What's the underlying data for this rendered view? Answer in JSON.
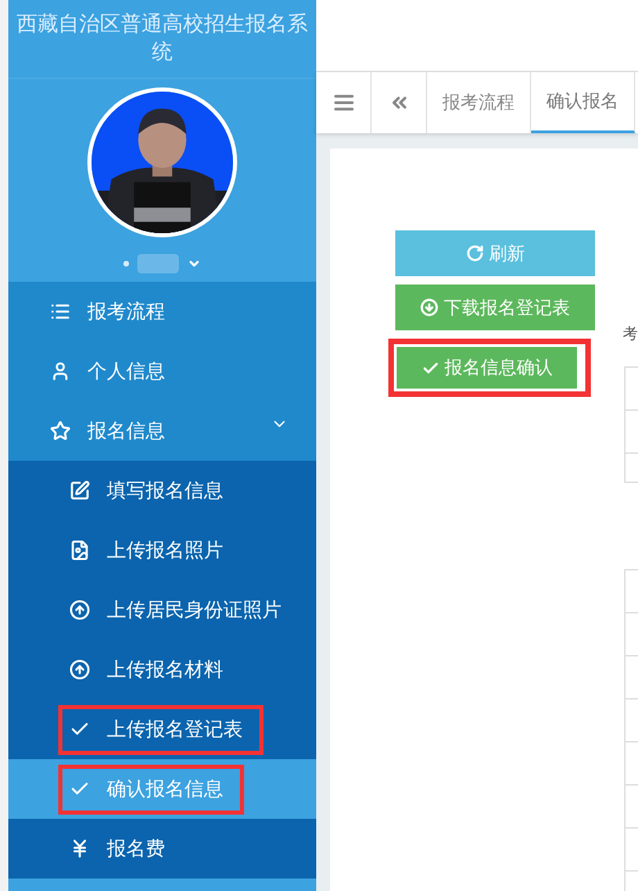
{
  "sidebar": {
    "title": "西藏自治区普通高校招生报名系统",
    "items": [
      {
        "label": "报考流程",
        "selected": false,
        "annotated": false
      },
      {
        "label": "个人信息",
        "selected": false,
        "annotated": false
      },
      {
        "label": "报名信息",
        "selected": false,
        "annotated": false,
        "expanded": true,
        "children": [
          {
            "label": "填写报名信息",
            "selected": false,
            "annotated": false
          },
          {
            "label": "上传报名照片",
            "selected": false,
            "annotated": false
          },
          {
            "label": "上传居民身份证照片",
            "selected": false,
            "annotated": false
          },
          {
            "label": "上传报名材料",
            "selected": false,
            "annotated": false
          },
          {
            "label": "上传报名登记表",
            "selected": false,
            "annotated": true
          },
          {
            "label": "确认报名信息",
            "selected": true,
            "annotated": true
          },
          {
            "label": "报名费",
            "selected": false,
            "annotated": false
          }
        ]
      }
    ]
  },
  "tabs": [
    {
      "label": "报考流程",
      "selected": false
    },
    {
      "label": "确认报名",
      "selected": true
    }
  ],
  "buttons": [
    {
      "label": "刷新",
      "kind": "refresh",
      "annotated": false
    },
    {
      "label": "下载报名登记表",
      "kind": "download",
      "annotated": false
    },
    {
      "label": "报名信息确认",
      "kind": "confirm",
      "annotated": true
    }
  ],
  "form": {
    "label": "考"
  }
}
